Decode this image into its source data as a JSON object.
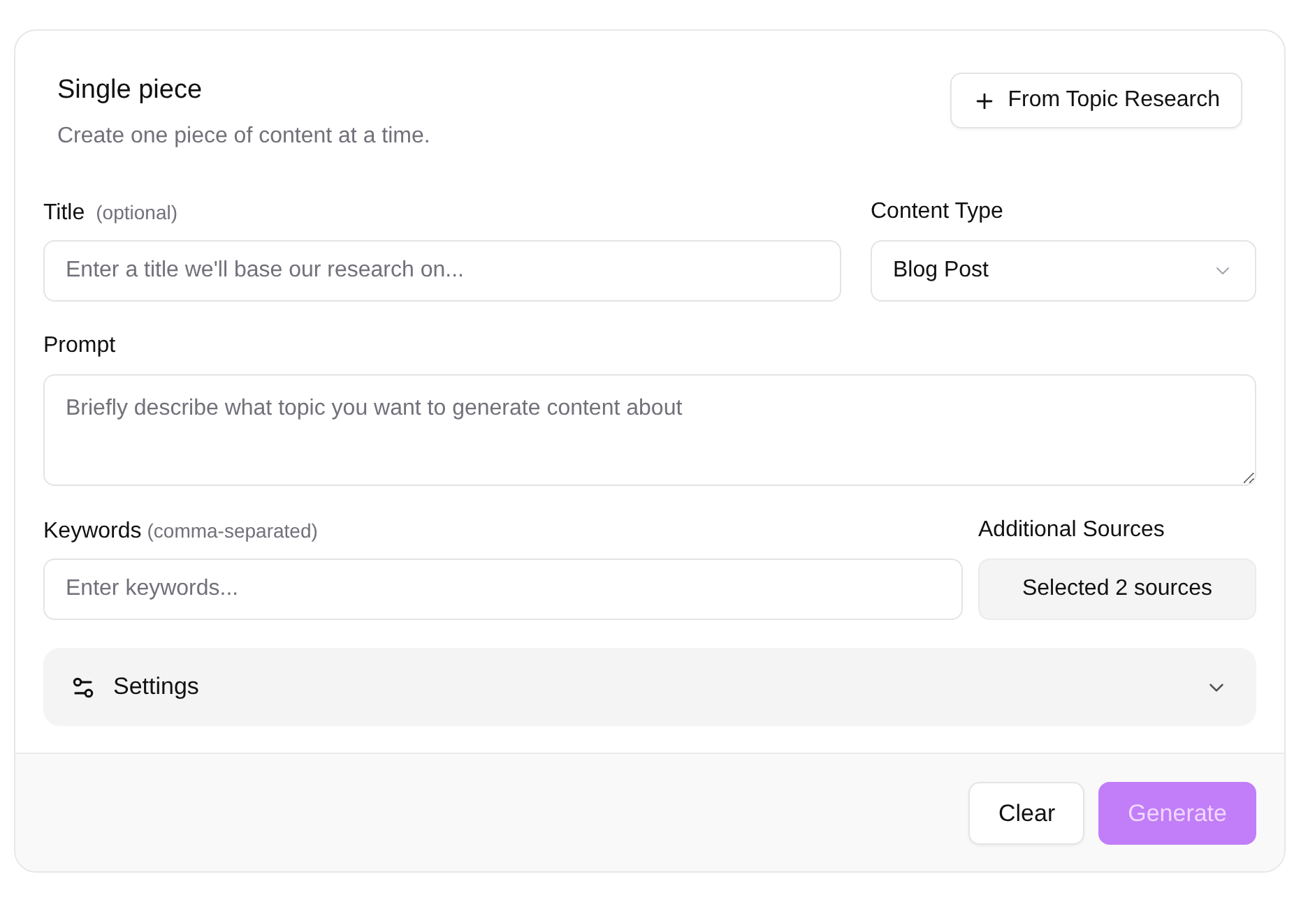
{
  "card": {
    "title": "Single piece",
    "subtitle": "Create one piece of content at a time.",
    "action_button": "From Topic Research"
  },
  "form": {
    "title_field": {
      "label": "Title",
      "hint": "(optional)",
      "placeholder": "Enter a title we'll base our research on..."
    },
    "content_type": {
      "label": "Content Type",
      "value": "Blog Post"
    },
    "prompt": {
      "label": "Prompt",
      "placeholder": "Briefly describe what topic you want to generate content about"
    },
    "keywords": {
      "label": "Keywords",
      "hint": "(comma-separated)",
      "placeholder": "Enter keywords..."
    },
    "additional_sources": {
      "label": "Additional Sources",
      "button": "Selected 2 sources"
    }
  },
  "settings": {
    "label": "Settings",
    "expanded": false
  },
  "footer": {
    "buttons": [
      {
        "label": "Clear",
        "kind": "secondary",
        "disabled": false
      },
      {
        "label": "Generate",
        "kind": "primary",
        "disabled": true
      }
    ]
  }
}
